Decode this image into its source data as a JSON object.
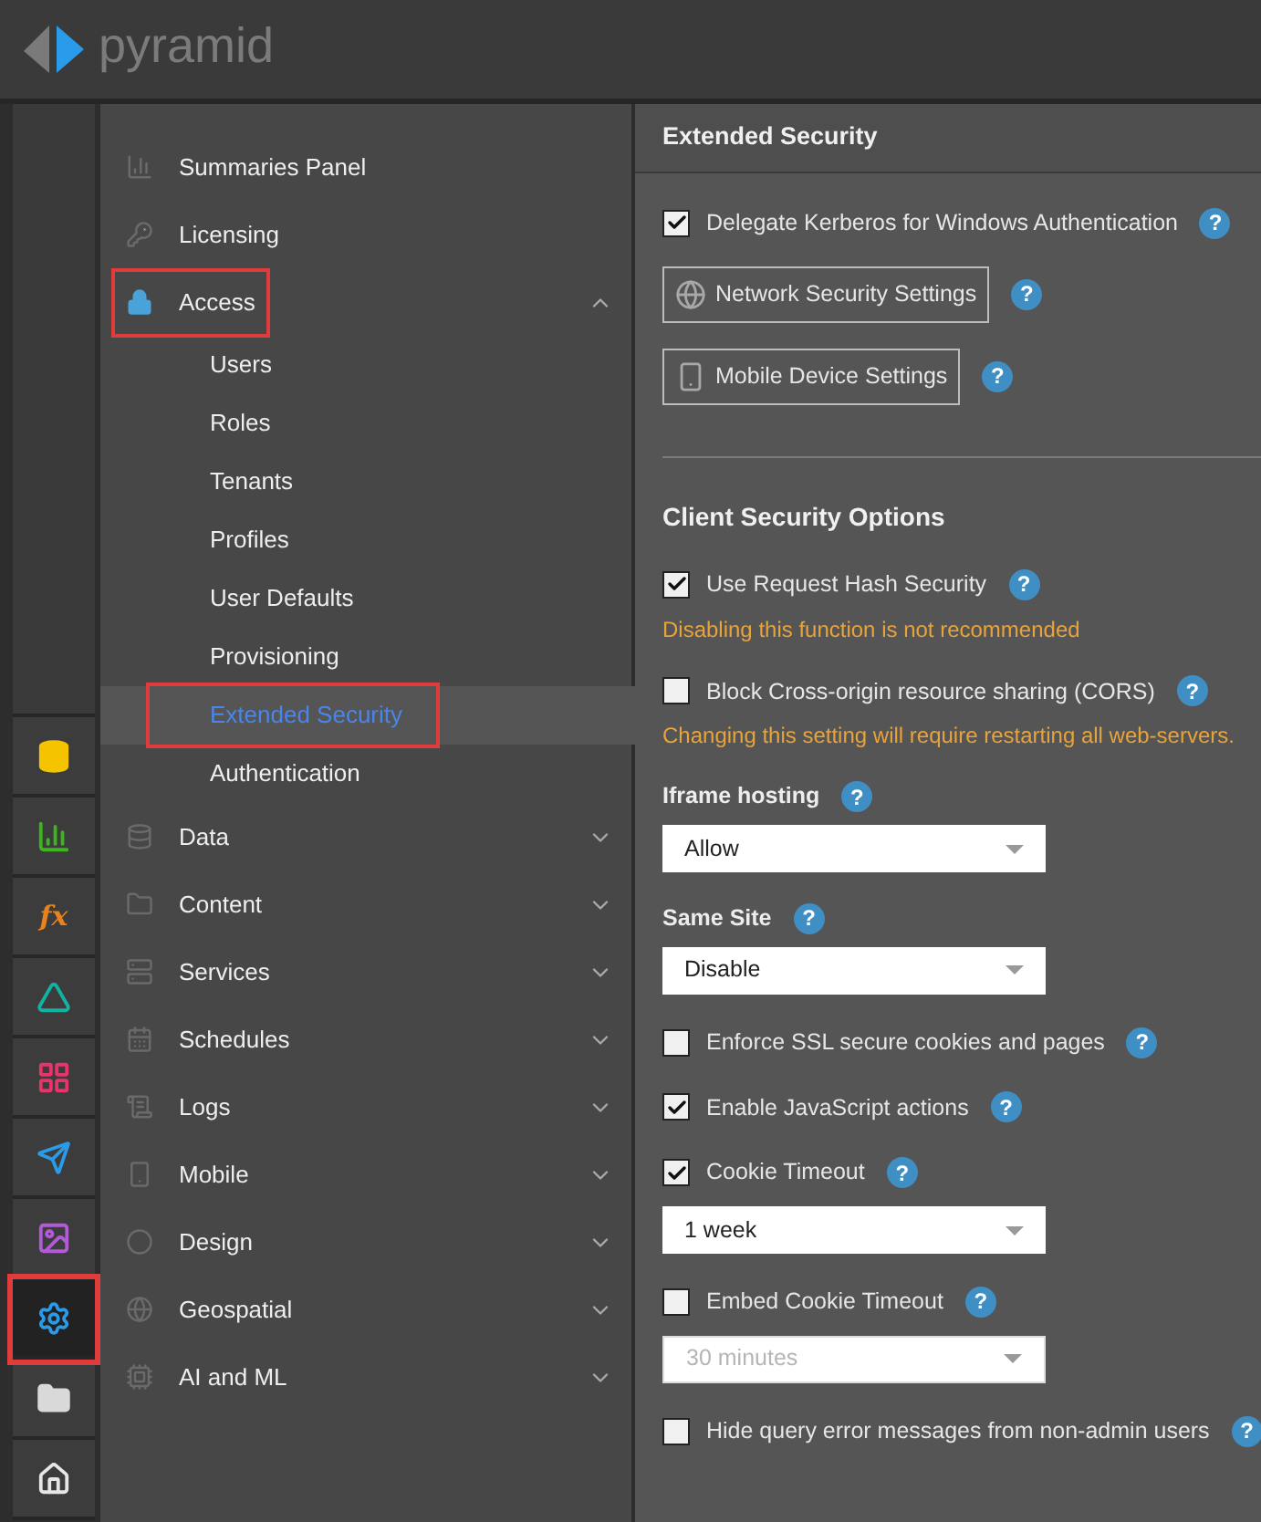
{
  "header": {
    "logo_text": "pyramid"
  },
  "rail": [
    {
      "selected": false,
      "highlighted": false
    },
    {
      "selected": false,
      "highlighted": false
    },
    {
      "text": "fx",
      "selected": false,
      "highlighted": false
    },
    {
      "selected": false,
      "highlighted": false
    },
    {
      "selected": false,
      "highlighted": false
    },
    {
      "selected": false,
      "highlighted": false
    },
    {
      "selected": false,
      "highlighted": false
    },
    {
      "selected": true,
      "highlighted": true
    },
    {
      "selected": false,
      "highlighted": false
    },
    {
      "selected": false,
      "highlighted": false
    }
  ],
  "nav": [
    {
      "kind": "link",
      "label": "Summaries Panel",
      "highlighted": false
    },
    {
      "kind": "link",
      "label": "Licensing",
      "highlighted": false
    },
    {
      "kind": "group",
      "label": "Access",
      "expanded": true,
      "highlighted": true,
      "children": [
        {
          "label": "Users",
          "selected": false,
          "highlighted": false
        },
        {
          "label": "Roles",
          "selected": false,
          "highlighted": false
        },
        {
          "label": "Tenants",
          "selected": false,
          "highlighted": false
        },
        {
          "label": "Profiles",
          "selected": false,
          "highlighted": false
        },
        {
          "label": "User Defaults",
          "selected": false,
          "highlighted": false
        },
        {
          "label": "Provisioning",
          "selected": false,
          "highlighted": false
        },
        {
          "label": "Extended Security",
          "selected": true,
          "highlighted": true
        },
        {
          "label": "Authentication",
          "selected": false,
          "highlighted": false
        }
      ]
    },
    {
      "kind": "group",
      "label": "Data",
      "expanded": false,
      "highlighted": false
    },
    {
      "kind": "group",
      "label": "Content",
      "expanded": false,
      "highlighted": false
    },
    {
      "kind": "group",
      "label": "Services",
      "expanded": false,
      "highlighted": false
    },
    {
      "kind": "group",
      "label": "Schedules",
      "expanded": false,
      "highlighted": false
    },
    {
      "kind": "group",
      "label": "Logs",
      "expanded": false,
      "highlighted": false
    },
    {
      "kind": "group",
      "label": "Mobile",
      "expanded": false,
      "highlighted": false
    },
    {
      "kind": "group",
      "label": "Design",
      "expanded": false,
      "highlighted": false
    },
    {
      "kind": "group",
      "label": "Geospatial",
      "expanded": false,
      "highlighted": false
    },
    {
      "kind": "group",
      "label": "AI and ML",
      "expanded": false,
      "highlighted": false
    }
  ],
  "panel": {
    "title": "Extended Security",
    "items": [
      {
        "kind": "checkbox",
        "label": "Delegate Kerberos for Windows Authentication",
        "checked": true,
        "help": "?"
      },
      {
        "kind": "button",
        "label": "Network Security Settings",
        "help": "?"
      },
      {
        "kind": "button",
        "label": "Mobile Device Settings",
        "help": "?"
      },
      {
        "kind": "divider"
      },
      {
        "kind": "heading",
        "label": "Client Security Options"
      },
      {
        "kind": "checkbox",
        "label": "Use Request Hash Security",
        "checked": true,
        "help": "?",
        "note": "Disabling this function is not recommended"
      },
      {
        "kind": "checkbox",
        "label": "Block Cross-origin resource sharing (CORS)",
        "checked": false,
        "help": "?",
        "note": "Changing this setting will require restarting all web-servers."
      },
      {
        "kind": "select",
        "label": "Iframe hosting",
        "help": "?",
        "value": "Allow",
        "disabled": false
      },
      {
        "kind": "select",
        "label": "Same Site",
        "help": "?",
        "value": "Disable",
        "disabled": false
      },
      {
        "kind": "checkbox",
        "label": "Enforce SSL secure cookies and pages",
        "checked": false,
        "help": "?"
      },
      {
        "kind": "checkbox",
        "label": "Enable JavaScript actions",
        "checked": true,
        "help": "?"
      },
      {
        "kind": "checkbox",
        "label": "Cookie Timeout",
        "checked": true,
        "help": "?",
        "select": {
          "value": "1 week",
          "disabled": false
        }
      },
      {
        "kind": "checkbox",
        "label": "Embed Cookie Timeout",
        "checked": false,
        "help": "?",
        "select": {
          "value": "30 minutes",
          "disabled": true
        }
      },
      {
        "kind": "checkbox",
        "label": "Hide query error messages from non-admin users",
        "checked": false,
        "help": "?"
      }
    ]
  }
}
